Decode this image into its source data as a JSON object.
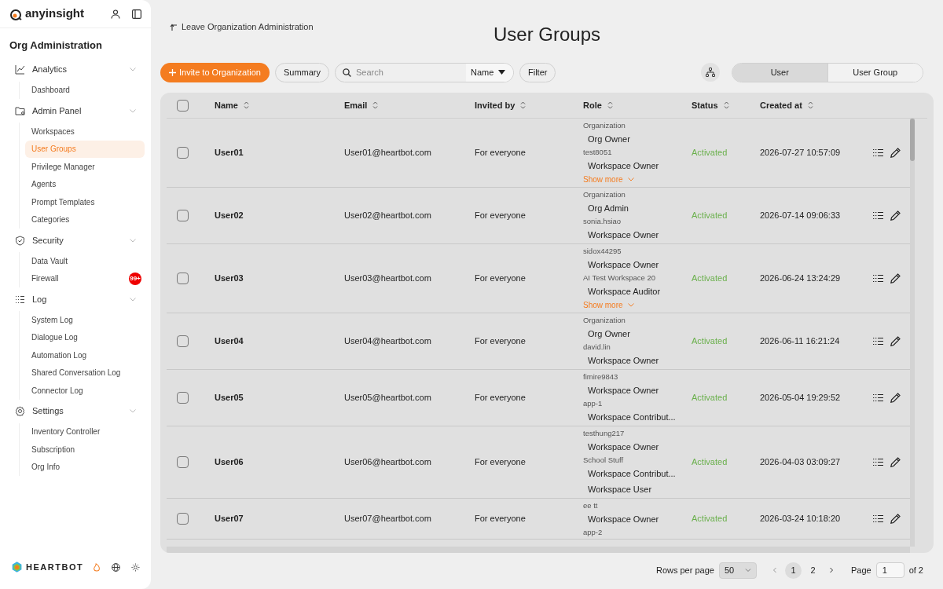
{
  "sidebar": {
    "brand": "anyinsight",
    "title": "Org Administration",
    "groups": [
      {
        "label": "Analytics",
        "expanded": true,
        "children": [
          {
            "label": "Dashboard",
            "selected": false
          }
        ]
      },
      {
        "label": "Admin Panel",
        "expanded": true,
        "children": [
          {
            "label": "Workspaces",
            "selected": false
          },
          {
            "label": "User Groups",
            "selected": true
          },
          {
            "label": "Privilege Manager",
            "selected": false
          },
          {
            "label": "Agents",
            "selected": false
          },
          {
            "label": "Prompt Templates",
            "selected": false
          },
          {
            "label": "Categories",
            "selected": false
          }
        ]
      },
      {
        "label": "Security",
        "expanded": true,
        "children": [
          {
            "label": "Data Vault",
            "selected": false
          },
          {
            "label": "Firewall",
            "selected": false,
            "badge": "99+"
          }
        ]
      },
      {
        "label": "Log",
        "expanded": true,
        "children": [
          {
            "label": "System Log",
            "selected": false
          },
          {
            "label": "Dialogue Log",
            "selected": false
          },
          {
            "label": "Automation Log",
            "selected": false
          },
          {
            "label": "Shared Conversation Log",
            "selected": false
          },
          {
            "label": "Connector Log",
            "selected": false
          }
        ]
      },
      {
        "label": "Settings",
        "expanded": true,
        "children": [
          {
            "label": "Inventory Controller",
            "selected": false
          },
          {
            "label": "Subscription",
            "selected": false
          },
          {
            "label": "Org Info",
            "selected": false
          }
        ]
      }
    ],
    "footer_brand": "HEARTBOT"
  },
  "back_link": "Leave Organization Administration",
  "title": "User Groups",
  "toolbar": {
    "invite": "Invite to Organization",
    "summary": "Summary",
    "search_placeholder": "Search",
    "search_by": "Name",
    "filter": "Filter",
    "view_toggle": [
      {
        "label": "User",
        "selected": true
      },
      {
        "label": "User Group",
        "selected": false
      }
    ]
  },
  "table": {
    "select_all_checked": false,
    "columns": [
      "Name",
      "Email",
      "Invited by",
      "Role",
      "Status",
      "Created at"
    ],
    "rows": [
      {
        "checked": false,
        "name": "User01",
        "email": "User01@heartbot.com",
        "invited_by": "For everyone",
        "roles": [
          {
            "scope": "Organization",
            "roles": [
              "Org Owner"
            ]
          },
          {
            "scope": "test8051",
            "roles": [
              "Workspace Owner"
            ]
          }
        ],
        "show_more": "Show more",
        "status": "Activated",
        "created_at": "2026-07-27 10:57:09"
      },
      {
        "checked": false,
        "name": "User02",
        "email": "User02@heartbot.com",
        "invited_by": "For everyone",
        "roles": [
          {
            "scope": "Organization",
            "roles": [
              "Org Admin"
            ]
          },
          {
            "scope": "sonia.hsiao",
            "roles": [
              "Workspace Owner"
            ]
          }
        ],
        "status": "Activated",
        "created_at": "2026-07-14 09:06:33"
      },
      {
        "checked": false,
        "name": "User03",
        "email": "User03@heartbot.com",
        "invited_by": "For everyone",
        "roles": [
          {
            "scope": "sidox44295",
            "roles": [
              "Workspace Owner"
            ]
          },
          {
            "scope": "AI Test Workspace 20",
            "roles": [
              "Workspace Auditor"
            ]
          }
        ],
        "show_more": "Show more",
        "status": "Activated",
        "created_at": "2026-06-24 13:24:29"
      },
      {
        "checked": false,
        "name": "User04",
        "email": "User04@heartbot.com",
        "invited_by": "For everyone",
        "roles": [
          {
            "scope": "Organization",
            "roles": [
              "Org Owner"
            ]
          },
          {
            "scope": "david.lin",
            "roles": [
              "Workspace Owner"
            ]
          }
        ],
        "status": "Activated",
        "created_at": "2026-06-11 16:21:24"
      },
      {
        "checked": false,
        "name": "User05",
        "email": "User05@heartbot.com",
        "invited_by": "For everyone",
        "roles": [
          {
            "scope": "fimire9843",
            "roles": [
              "Workspace Owner"
            ]
          },
          {
            "scope": "app-1",
            "roles": [
              "Workspace Contribut..."
            ]
          }
        ],
        "status": "Activated",
        "created_at": "2026-05-04 19:29:52"
      },
      {
        "checked": false,
        "name": "User06",
        "email": "User06@heartbot.com",
        "invited_by": "For everyone",
        "roles": [
          {
            "scope": "testhung217",
            "roles": [
              "Workspace Owner"
            ]
          },
          {
            "scope": "School Stuff",
            "roles": [
              "Workspace Contribut...",
              "Workspace User"
            ]
          }
        ],
        "status": "Activated",
        "created_at": "2026-04-03 03:09:27"
      },
      {
        "checked": false,
        "name": "User07",
        "email": "User07@heartbot.com",
        "invited_by": "For everyone",
        "roles": [
          {
            "scope": "ee tt",
            "roles": [
              "Workspace Owner"
            ]
          },
          {
            "scope": "app-2"
          }
        ],
        "status": "Activated",
        "created_at": "2026-03-24 10:18:20"
      }
    ]
  },
  "pagination": {
    "rows_label": "Rows per page",
    "rows_value": "50",
    "pages": [
      {
        "label": "1",
        "selected": true
      },
      {
        "label": "2",
        "selected": false
      }
    ],
    "page_label": "Page",
    "page_value": "1",
    "of_label": "of 2"
  }
}
